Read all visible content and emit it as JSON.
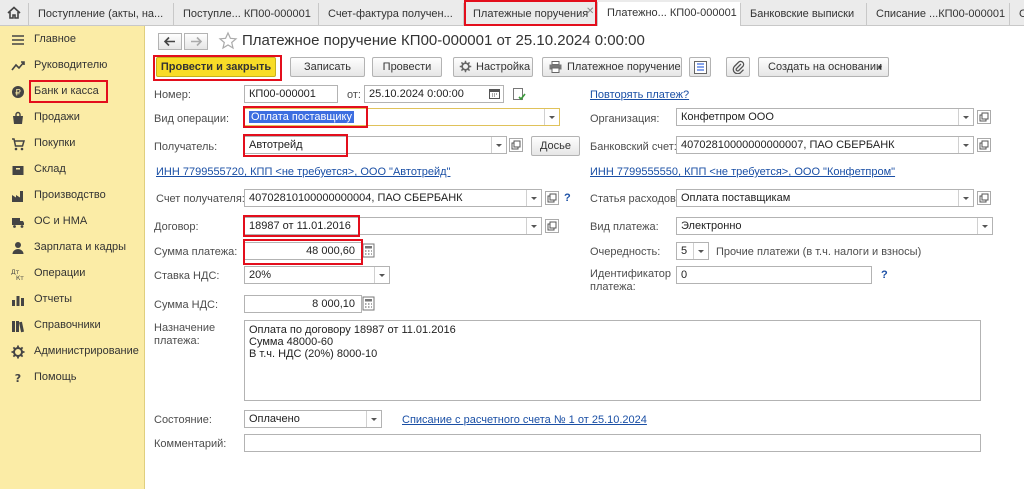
{
  "tabs": [
    {
      "label": "Поступление (акты, на..."
    },
    {
      "label": "Поступле... КП00-000001"
    },
    {
      "label": "Счет-фактура получен..."
    },
    {
      "label": "Платежные поручения"
    },
    {
      "label": "Платежно... КП00-000001"
    },
    {
      "label": "Банковские выписки"
    },
    {
      "label": "Списание ...КП00-000001"
    },
    {
      "label": "С"
    }
  ],
  "sidebar": {
    "items": [
      {
        "label": "Главное",
        "icon": "menu-icon"
      },
      {
        "label": "Руководителю",
        "icon": "trend-icon"
      },
      {
        "label": "Банк и касса",
        "icon": "coin-icon"
      },
      {
        "label": "Продажи",
        "icon": "bag-icon"
      },
      {
        "label": "Покупки",
        "icon": "cart-icon"
      },
      {
        "label": "Склад",
        "icon": "box-icon"
      },
      {
        "label": "Производство",
        "icon": "factory-icon"
      },
      {
        "label": "ОС и НМА",
        "icon": "truck-icon"
      },
      {
        "label": "Зарплата и кадры",
        "icon": "person-icon"
      },
      {
        "label": "Операции",
        "icon": "dt-kt-icon"
      },
      {
        "label": "Отчеты",
        "icon": "bar-chart-icon"
      },
      {
        "label": "Справочники",
        "icon": "books-icon"
      },
      {
        "label": "Администрирование",
        "icon": "gear-icon"
      },
      {
        "label": "Помощь",
        "icon": "question-icon"
      }
    ]
  },
  "form": {
    "title": "Платежное поручение КП00-000001 от 25.10.2024 0:00:00",
    "buttons": {
      "post_close": "Провести и закрыть",
      "save": "Записать",
      "post": "Провести",
      "settings": "Настройка",
      "payment_order": "Платежное поручение",
      "create_based": "Создать на основании"
    },
    "number_label": "Номер:",
    "number": "КП00-000001",
    "date_label": "от:",
    "date": "25.10.2024  0:00:00",
    "repeat_link": "Повторять платеж?",
    "operation_label": "Вид операции:",
    "operation": "Оплата поставщику",
    "organization_label": "Организация:",
    "organization": "Конфетпром ООО",
    "recipient_label": "Получатель:",
    "recipient": "Автотрейд",
    "dossier_label": "Досье",
    "bank_account_label": "Банковский счет:",
    "bank_account": "40702810000000000007, ПАО СБЕРБАНК",
    "recipient_inn_link": "ИНН 7799555720, КПП <не требуется>, ООО \"Автотрейд\"",
    "org_inn_link": "ИНН 7799555550, КПП <не требуется>, ООО \"Конфетпром\"",
    "recipient_account_label": "Счет получателя:",
    "recipient_account": "40702810100000000004, ПАО СБЕРБАНК",
    "help_mark": "?",
    "expense_item_label": "Статья расходов:",
    "expense_item": "Оплата поставщикам",
    "contract_label": "Договор:",
    "contract": "18987 от 11.01.2016",
    "payment_type_label": "Вид платежа:",
    "payment_type": "Электронно",
    "amount_label": "Сумма платежа:",
    "amount": "48 000,60",
    "priority_label": "Очередность:",
    "priority": "5",
    "priority_desc": "Прочие платежи (в т.ч. налоги и взносы)",
    "vat_rate_label": "Ставка НДС:",
    "vat_rate": "20%",
    "payment_id_label_1": "Идентификатор",
    "payment_id_label_2": "платежа:",
    "payment_id": "0",
    "vat_amount_label": "Сумма НДС:",
    "vat_amount": "8 000,10",
    "purpose_label_1": "Назначение",
    "purpose_label_2": "платежа:",
    "purpose_lines": [
      "Оплата по договору 18987 от 11.01.2016",
      "Сумма 48000-60",
      "В т.ч. НДС  (20%) 8000-10"
    ],
    "status_label": "Состояние:",
    "status": "Оплачено",
    "writeoff_link": "Списание с расчетного счета № 1 от 25.10.2024",
    "comment_label": "Комментарий:",
    "comment": ""
  },
  "colors": {
    "sidebar_bg": "#fbeca6",
    "primary_button": "#f8dc27",
    "highlight": "#e30e1c",
    "link": "#1a4fa5",
    "selection": "#3d6ee0"
  }
}
